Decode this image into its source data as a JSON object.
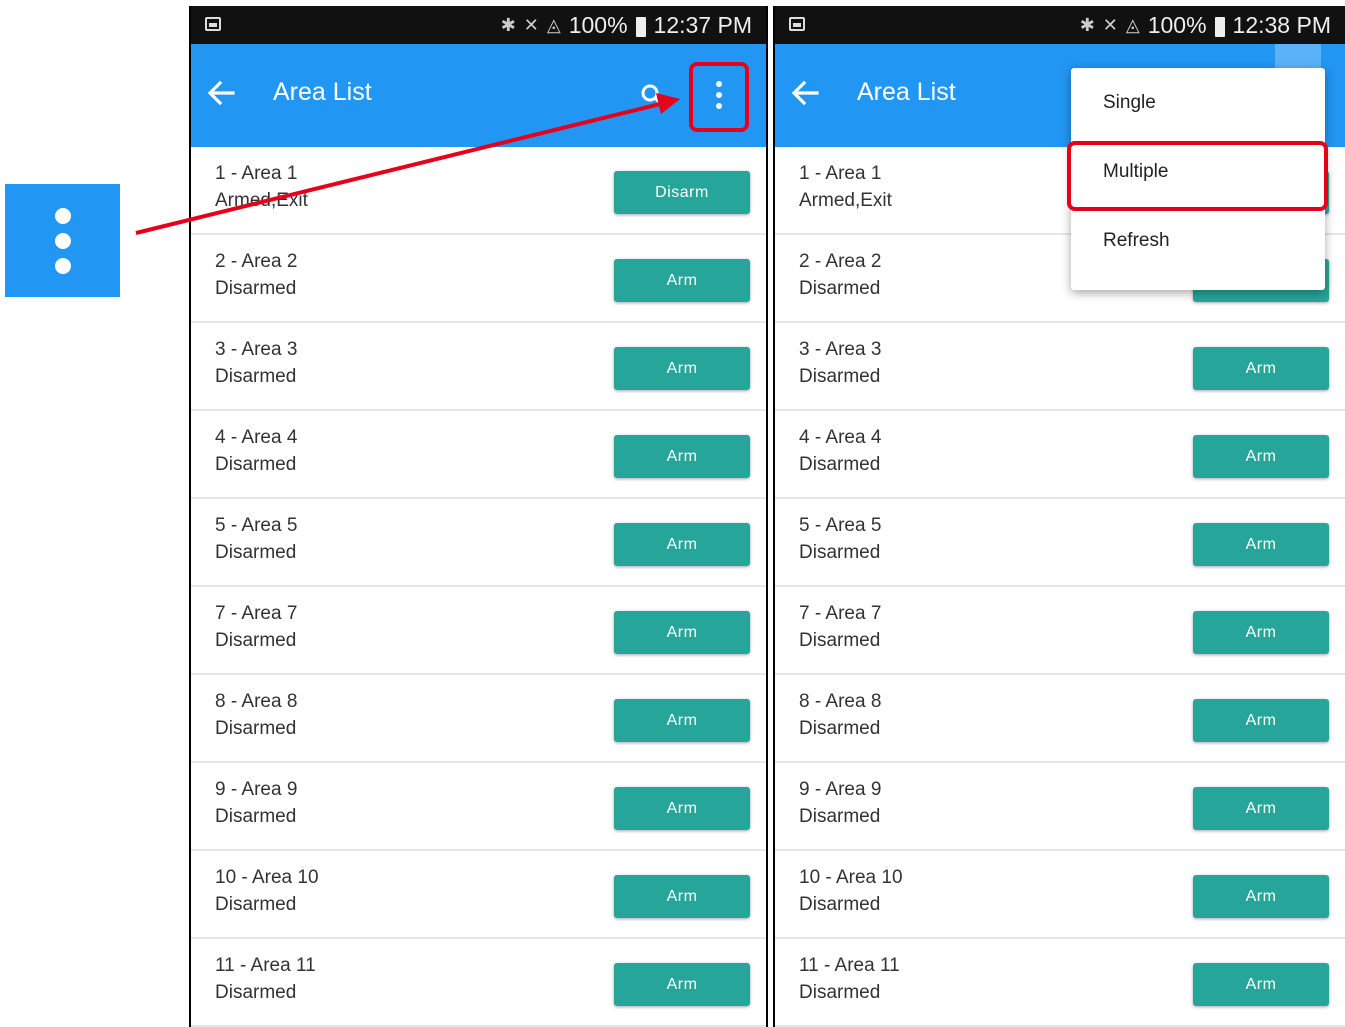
{
  "callout": {
    "icon": "more-vert-icon"
  },
  "screens": [
    {
      "status": {
        "signal_text": "100%",
        "time": "12:37 PM"
      },
      "appbar": {
        "title": "Area List",
        "back_icon": "arrow-left-icon",
        "search_icon": "search-icon",
        "menu_icon": "more-vert-icon"
      },
      "areas": [
        {
          "name": "1 - Area 1",
          "state": "Armed,Exit",
          "button": "Disarm"
        },
        {
          "name": "2 - Area 2",
          "state": "Disarmed",
          "button": "Arm"
        },
        {
          "name": "3 - Area 3",
          "state": "Disarmed",
          "button": "Arm"
        },
        {
          "name": "4 - Area 4",
          "state": "Disarmed",
          "button": "Arm"
        },
        {
          "name": "5 - Area 5",
          "state": "Disarmed",
          "button": "Arm"
        },
        {
          "name": "7 - Area 7",
          "state": "Disarmed",
          "button": "Arm"
        },
        {
          "name": "8 - Area 8",
          "state": "Disarmed",
          "button": "Arm"
        },
        {
          "name": "9 - Area 9",
          "state": "Disarmed",
          "button": "Arm"
        },
        {
          "name": "10 - Area 10",
          "state": "Disarmed",
          "button": "Arm"
        },
        {
          "name": "11 - Area 11",
          "state": "Disarmed",
          "button": "Arm"
        }
      ]
    },
    {
      "status": {
        "signal_text": "100%",
        "time": "12:38 PM"
      },
      "appbar": {
        "title": "Area List",
        "back_icon": "arrow-left-icon"
      },
      "menu": [
        "Single",
        "Multiple",
        "Refresh"
      ],
      "areas": [
        {
          "name": "1 - Area 1",
          "state": "Armed,Exit",
          "button": ""
        },
        {
          "name": "2 - Area 2",
          "state": "Disarmed",
          "button": ""
        },
        {
          "name": "3 - Area 3",
          "state": "Disarmed",
          "button": "Arm"
        },
        {
          "name": "4 - Area 4",
          "state": "Disarmed",
          "button": "Arm"
        },
        {
          "name": "5 - Area 5",
          "state": "Disarmed",
          "button": "Arm"
        },
        {
          "name": "7 - Area 7",
          "state": "Disarmed",
          "button": "Arm"
        },
        {
          "name": "8 - Area 8",
          "state": "Disarmed",
          "button": "Arm"
        },
        {
          "name": "9 - Area 9",
          "state": "Disarmed",
          "button": "Arm"
        },
        {
          "name": "10 - Area 10",
          "state": "Disarmed",
          "button": "Arm"
        },
        {
          "name": "11 - Area 11",
          "state": "Disarmed",
          "button": "Arm"
        }
      ]
    }
  ],
  "colors": {
    "appbar": "#2196f3",
    "button": "#26a69a",
    "highlight": "#e5001c",
    "statusbar": "#111111"
  }
}
